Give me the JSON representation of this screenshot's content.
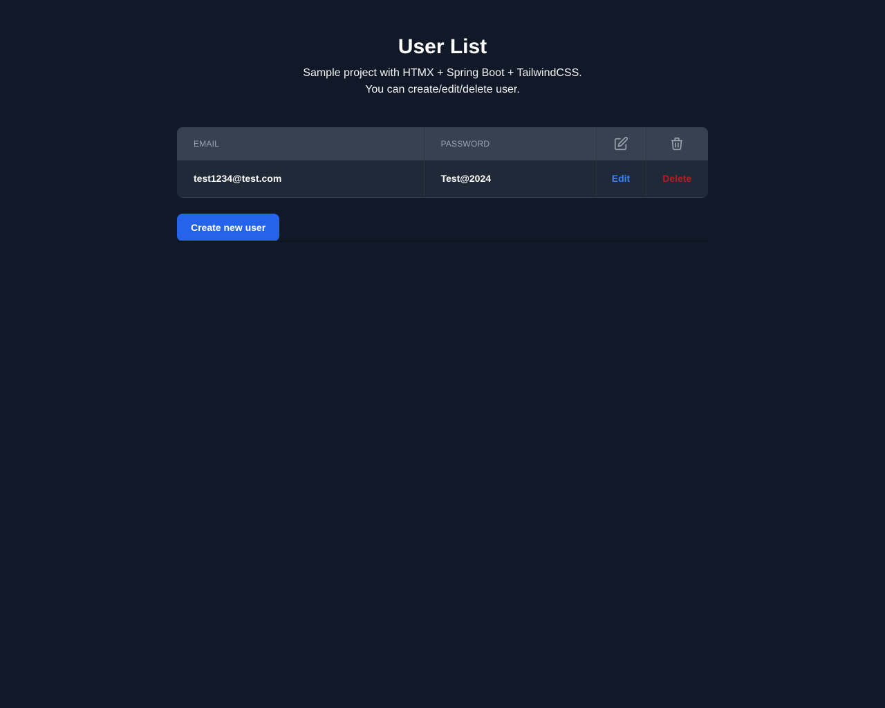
{
  "header": {
    "title": "User List",
    "subtitle_line1": "Sample project with HTMX + Spring Boot + TailwindCSS.",
    "subtitle_line2": "You can create/edit/delete user."
  },
  "table": {
    "columns": {
      "email": "EMAIL",
      "password": "PASSWORD",
      "edit_icon": "edit-icon",
      "delete_icon": "trash-icon"
    },
    "rows": [
      {
        "email": "test1234@test.com",
        "password": "Test@2024",
        "edit_label": "Edit",
        "delete_label": "Delete"
      }
    ]
  },
  "actions": {
    "create_label": "Create new user"
  },
  "colors": {
    "background": "#111827",
    "header_row": "#374151",
    "body_row": "#1f2937",
    "primary": "#2563eb",
    "edit_link": "#3b82f6",
    "delete_link": "#b91c1c"
  }
}
